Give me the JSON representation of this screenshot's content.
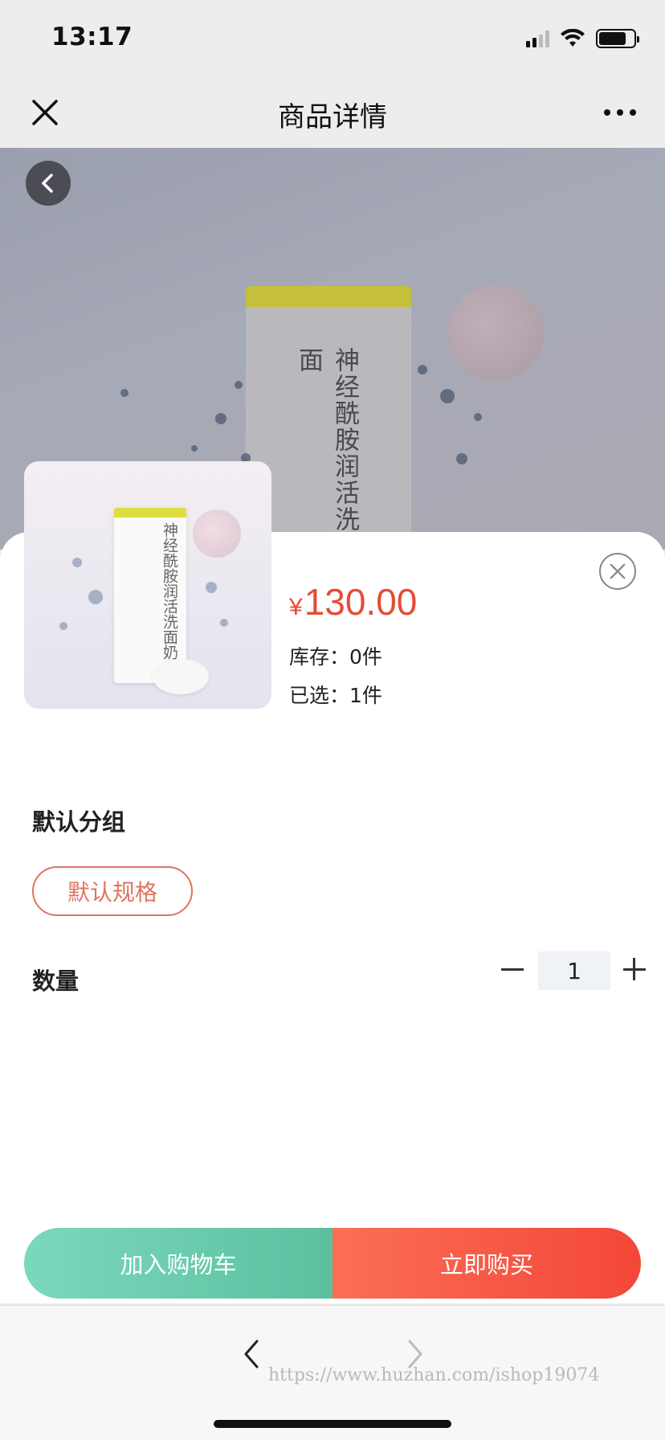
{
  "status_bar": {
    "time": "13:17"
  },
  "nav": {
    "title": "商品详情"
  },
  "hero": {
    "tube_text": "神经酰胺润活洗面"
  },
  "thumbnail": {
    "tube_text": "神经酰胺润活洗面奶"
  },
  "product": {
    "price_symbol": "¥",
    "price": "130.00",
    "stock": "库存：0件",
    "selected": "已选：1件"
  },
  "spec": {
    "group_title": "默认分组",
    "option": "默认规格"
  },
  "quantity": {
    "label": "数量",
    "value": "1"
  },
  "actions": {
    "add_to_cart": "加入购物车",
    "buy_now": "立即购买"
  },
  "watermark": "https://www.huzhan.com/ishop19074",
  "colors": {
    "accent_price": "#e44d35",
    "cart_button": "#5cc0a0",
    "buy_button": "#f34639",
    "spec_chip_border": "#e0735f"
  },
  "icons": [
    "close-icon",
    "more-icon",
    "back-icon",
    "circle-close-icon",
    "minus-icon",
    "plus-icon",
    "chevron-left-icon",
    "chevron-right-icon"
  ]
}
